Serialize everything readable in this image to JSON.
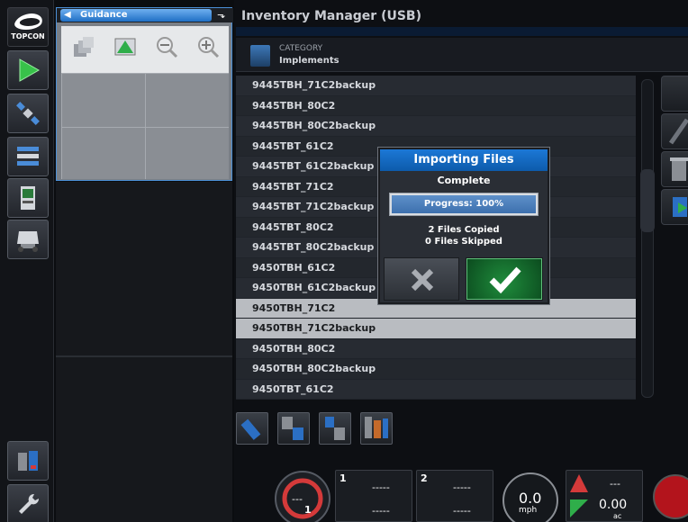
{
  "app": {
    "brand": "TOPCON"
  },
  "guidance": {
    "tab_label": "Guidance",
    "tools": [
      "layers-icon",
      "field-icon",
      "zoom-out-icon",
      "zoom-in-icon"
    ]
  },
  "inventory": {
    "title": "Inventory Manager (USB)",
    "category_label": "CATEGORY",
    "category_value": "Implements",
    "rows": [
      {
        "name": "9445TBH_71C2backup",
        "selected": false
      },
      {
        "name": "9445TBH_80C2",
        "selected": false
      },
      {
        "name": "9445TBH_80C2backup",
        "selected": false
      },
      {
        "name": "9445TBT_61C2",
        "selected": false
      },
      {
        "name": "9445TBT_61C2backup",
        "selected": false
      },
      {
        "name": "9445TBT_71C2",
        "selected": false
      },
      {
        "name": "9445TBT_71C2backup",
        "selected": false
      },
      {
        "name": "9445TBT_80C2",
        "selected": false
      },
      {
        "name": "9445TBT_80C2backup",
        "selected": false
      },
      {
        "name": "9450TBH_61C2",
        "selected": false
      },
      {
        "name": "9450TBH_61C2backup",
        "selected": false
      },
      {
        "name": "9450TBH_71C2",
        "selected": true
      },
      {
        "name": "9450TBH_71C2backup",
        "selected": true
      },
      {
        "name": "9450TBH_80C2",
        "selected": false
      },
      {
        "name": "9450TBH_80C2backup",
        "selected": false
      },
      {
        "name": "9450TBT_61C2",
        "selected": false
      }
    ]
  },
  "dialog": {
    "title": "Importing Files",
    "status": "Complete",
    "progress_text": "Progress: 100%",
    "progress_value": 1.0,
    "files_copied": "2 Files Copied",
    "files_skipped": "0 Files Skipped"
  },
  "statusbar": {
    "section1_label": "1",
    "section1_value_a": "-----",
    "section1_value_b": "-----",
    "section2_label": "2",
    "section2_value_a": "-----",
    "section2_value_b": "-----",
    "speed": "0.0",
    "speed_unit": "mph",
    "area_top": "---",
    "area_value": "0.00",
    "area_unit": "ac",
    "dial_center": "---",
    "dial_number": "1"
  }
}
